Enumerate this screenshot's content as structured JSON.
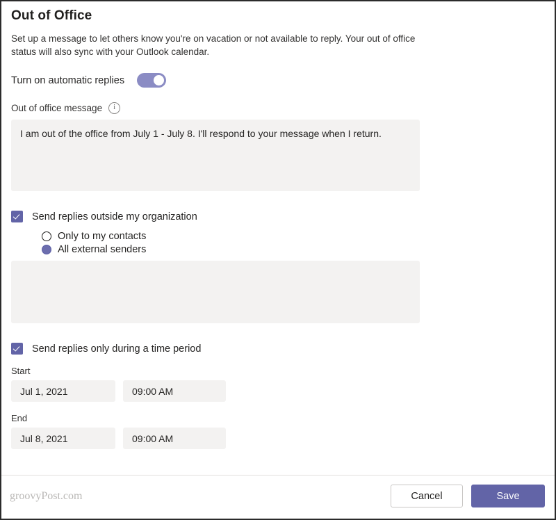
{
  "dialog": {
    "title": "Out of Office",
    "description": "Set up a message to let others know you're on vacation or not available to reply. Your out of office status will also sync with your Outlook calendar."
  },
  "automatic_replies": {
    "label": "Turn on automatic replies",
    "enabled": "on"
  },
  "message_field": {
    "label": "Out of office message",
    "info_icon": "i",
    "value": "I am out of the office from July 1 - July 8. I'll respond to your message when I return."
  },
  "outside_org": {
    "checkbox_label": "Send replies outside my organization",
    "checked": "true",
    "radios": [
      {
        "label": "Only to my contacts",
        "selected": "false"
      },
      {
        "label": "All external senders",
        "selected": "true"
      }
    ],
    "external_message_value": ""
  },
  "time_period": {
    "checkbox_label": "Send replies only during a time period",
    "checked": "true",
    "start": {
      "label": "Start",
      "date": "Jul 1, 2021",
      "time": "09:00 AM"
    },
    "end": {
      "label": "End",
      "date": "Jul 8, 2021",
      "time": "09:00 AM"
    }
  },
  "footer": {
    "watermark": "groovyPost.com",
    "cancel_label": "Cancel",
    "save_label": "Save"
  },
  "colors": {
    "accent": "#6264a7",
    "toggle_on": "#8b8cc4",
    "field_bg": "#f3f2f1"
  }
}
